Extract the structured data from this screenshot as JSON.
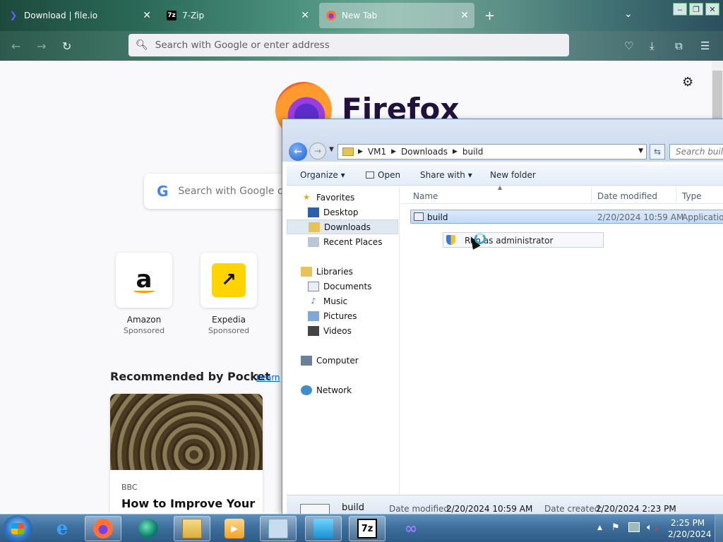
{
  "browser": {
    "tabs": [
      {
        "title": "Download | file.io",
        "icon": "file-io-icon"
      },
      {
        "title": "7-Zip",
        "icon": "7zip-icon",
        "icon_text": "7z"
      },
      {
        "title": "New Tab",
        "icon": "firefox-icon"
      }
    ],
    "active_tab": 2,
    "url_placeholder": "Search with Google or enter address"
  },
  "newtab": {
    "brand": "Firefox",
    "search_placeholder": "Search with Google or",
    "google_letter": "G",
    "tiles": [
      {
        "name": "Amazon",
        "label": "Sponsored",
        "logo": "a"
      },
      {
        "name": "Expedia",
        "label": "Sponsored",
        "logo": "↗"
      }
    ],
    "pocket": {
      "title": "Recommended by Pocket",
      "learn": "Learn",
      "card_source": "BBC",
      "card_title": "How to Improve Your"
    }
  },
  "explorer": {
    "breadcrumb": [
      "VM1",
      "Downloads",
      "build"
    ],
    "search_placeholder": "Search build",
    "commands": {
      "organize": "Organize",
      "open": "Open",
      "share": "Share with",
      "new_folder": "New folder"
    },
    "nav": {
      "favorites": "Favorites",
      "desktop": "Desktop",
      "downloads": "Downloads",
      "recent": "Recent Places",
      "libraries": "Libraries",
      "documents": "Documents",
      "music": "Music",
      "pictures": "Pictures",
      "videos": "Videos",
      "computer": "Computer",
      "network": "Network"
    },
    "columns": {
      "name": "Name",
      "date": "Date modified",
      "type": "Type"
    },
    "files": [
      {
        "name": "build",
        "date": "2/20/2024 10:59 AM",
        "type": "Application"
      }
    ],
    "context_menu": {
      "run_as_admin": "Run as administrator"
    },
    "details": {
      "name": "build",
      "modified_label": "Date modified:",
      "modified_value": "2/20/2024 10:59 AM",
      "created_label": "Date created:",
      "created_value": "2/20/2024 2:23 PM"
    }
  },
  "taskbar": {
    "clock_time": "2:25 PM",
    "clock_date": "2/20/2024",
    "seven_zip_text": "7z"
  }
}
